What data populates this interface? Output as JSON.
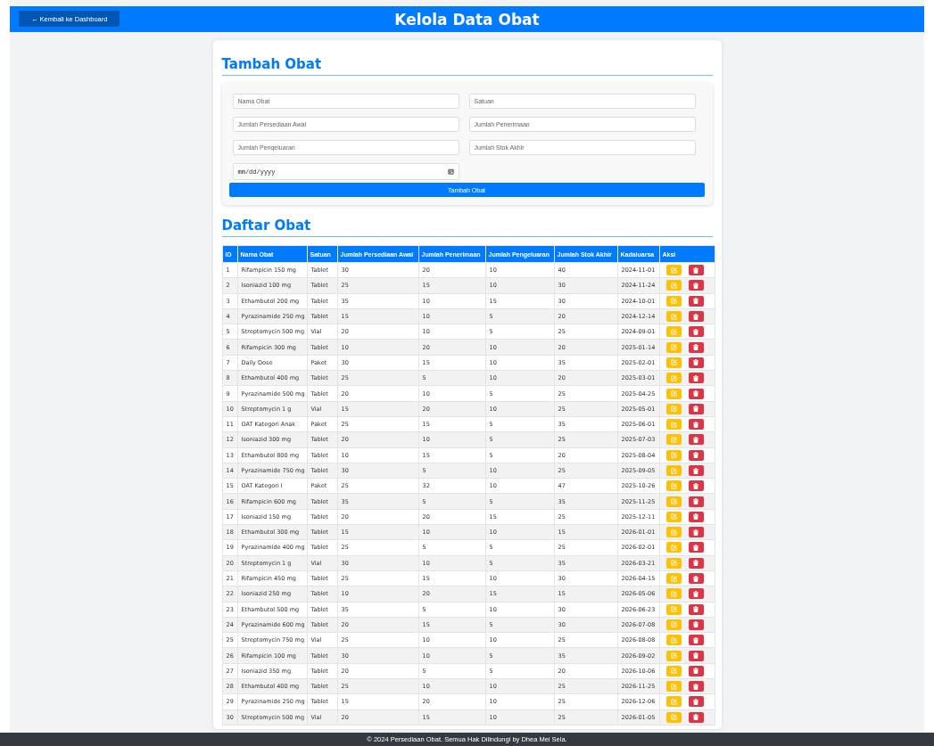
{
  "header": {
    "back_button": "← Kembali ke Dashboard",
    "title": "Kelola Data Obat"
  },
  "add_form": {
    "title": "Tambah Obat",
    "fields": [
      {
        "kind": "text",
        "placeholder": "Nama Obat"
      },
      {
        "kind": "text",
        "placeholder": "Satuan"
      },
      {
        "kind": "text",
        "placeholder": "Jumlah Persediaan Awal"
      },
      {
        "kind": "text",
        "placeholder": "Jumlah Penerimaan"
      },
      {
        "kind": "text",
        "placeholder": "Jumlah Pengeluaran"
      },
      {
        "kind": "text",
        "placeholder": "Jumlah Stok Akhir"
      },
      {
        "kind": "date",
        "placeholder": "mm/dd/yyyy"
      }
    ],
    "submit": "Tambah Obat"
  },
  "table": {
    "title": "Daftar Obat",
    "columns": [
      "ID",
      "Nama Obat",
      "Satuan",
      "Jumlah Persediaan Awal",
      "Jumlah Penerimaan",
      "Jumlah Pengeluaran",
      "Jumlah Stok Akhir",
      "Kadaluarsa",
      "Aksi"
    ],
    "rows": [
      [
        "1",
        "Rifampicin 150 mg",
        "Tablet",
        "30",
        "20",
        "10",
        "40",
        "2024-11-01"
      ],
      [
        "2",
        "Isoniazid 100 mg",
        "Tablet",
        "25",
        "15",
        "10",
        "30",
        "2024-11-24"
      ],
      [
        "3",
        "Ethambutol 200 mg",
        "Tablet",
        "35",
        "10",
        "15",
        "30",
        "2024-10-01"
      ],
      [
        "4",
        "Pyrazinamide 250 mg",
        "Tablet",
        "15",
        "10",
        "5",
        "20",
        "2024-12-14"
      ],
      [
        "5",
        "Streptomycin 500 mg",
        "Vial",
        "20",
        "10",
        "5",
        "25",
        "2024-09-01"
      ],
      [
        "6",
        "Rifampicin 300 mg",
        "Tablet",
        "10",
        "20",
        "10",
        "20",
        "2025-01-14"
      ],
      [
        "7",
        "Daily Dose",
        "Paket",
        "30",
        "15",
        "10",
        "35",
        "2025-02-01"
      ],
      [
        "8",
        "Ethambutol 400 mg",
        "Tablet",
        "25",
        "5",
        "10",
        "20",
        "2025-03-01"
      ],
      [
        "9",
        "Pyrazinamide 500 mg",
        "Tablet",
        "20",
        "10",
        "5",
        "25",
        "2025-04-25"
      ],
      [
        "10",
        "Streptomycin 1 g",
        "Vial",
        "15",
        "20",
        "10",
        "25",
        "2025-05-01"
      ],
      [
        "11",
        "OAT Kategori Anak",
        "Paket",
        "25",
        "15",
        "5",
        "35",
        "2025-06-01"
      ],
      [
        "12",
        "Isoniazid 300 mg",
        "Tablet",
        "20",
        "10",
        "5",
        "25",
        "2025-07-03"
      ],
      [
        "13",
        "Ethambutol 800 mg",
        "Tablet",
        "10",
        "15",
        "5",
        "20",
        "2025-08-04"
      ],
      [
        "14",
        "Pyrazinamide 750 mg",
        "Tablet",
        "30",
        "5",
        "10",
        "25",
        "2025-09-05"
      ],
      [
        "15",
        "OAT Kategori I",
        "Paket",
        "25",
        "32",
        "10",
        "47",
        "2025-10-26"
      ],
      [
        "16",
        "Rifampicin 600 mg",
        "Tablet",
        "35",
        "5",
        "5",
        "35",
        "2025-11-25"
      ],
      [
        "17",
        "Isoniazid 150 mg",
        "Tablet",
        "20",
        "20",
        "15",
        "25",
        "2025-12-11"
      ],
      [
        "18",
        "Ethambutol 300 mg",
        "Tablet",
        "15",
        "10",
        "10",
        "15",
        "2026-01-01"
      ],
      [
        "19",
        "Pyrazinamide 400 mg",
        "Tablet",
        "25",
        "5",
        "5",
        "25",
        "2026-02-01"
      ],
      [
        "20",
        "Streptomycin 1 g",
        "Vial",
        "30",
        "10",
        "5",
        "35",
        "2026-03-21"
      ],
      [
        "21",
        "Rifampicin 450 mg",
        "Tablet",
        "25",
        "15",
        "10",
        "30",
        "2026-04-15"
      ],
      [
        "22",
        "Isoniazid 250 mg",
        "Tablet",
        "10",
        "20",
        "15",
        "15",
        "2026-05-06"
      ],
      [
        "23",
        "Ethambutol 500 mg",
        "Tablet",
        "35",
        "5",
        "10",
        "30",
        "2026-06-23"
      ],
      [
        "24",
        "Pyrazinamide 600 mg",
        "Tablet",
        "20",
        "15",
        "5",
        "30",
        "2026-07-08"
      ],
      [
        "25",
        "Streptomycin 750 mg",
        "Vial",
        "25",
        "10",
        "10",
        "25",
        "2026-08-08"
      ],
      [
        "26",
        "Rifampicin 100 mg",
        "Tablet",
        "30",
        "10",
        "5",
        "35",
        "2026-09-02"
      ],
      [
        "27",
        "Isoniazid 350 mg",
        "Tablet",
        "20",
        "5",
        "5",
        "20",
        "2026-10-06"
      ],
      [
        "28",
        "Ethambutol 400 mg",
        "Tablet",
        "25",
        "10",
        "10",
        "25",
        "2026-11-25"
      ],
      [
        "29",
        "Pyrazinamide 250 mg",
        "Tablet",
        "15",
        "20",
        "10",
        "25",
        "2026-12-06"
      ],
      [
        "30",
        "Streptomycin 500 mg",
        "Vial",
        "20",
        "15",
        "10",
        "25",
        "2026-01-05"
      ]
    ]
  },
  "footer": "© 2024 Persediaan Obat. Semua Hak Dilindungi by Dhea Mei Sela."
}
